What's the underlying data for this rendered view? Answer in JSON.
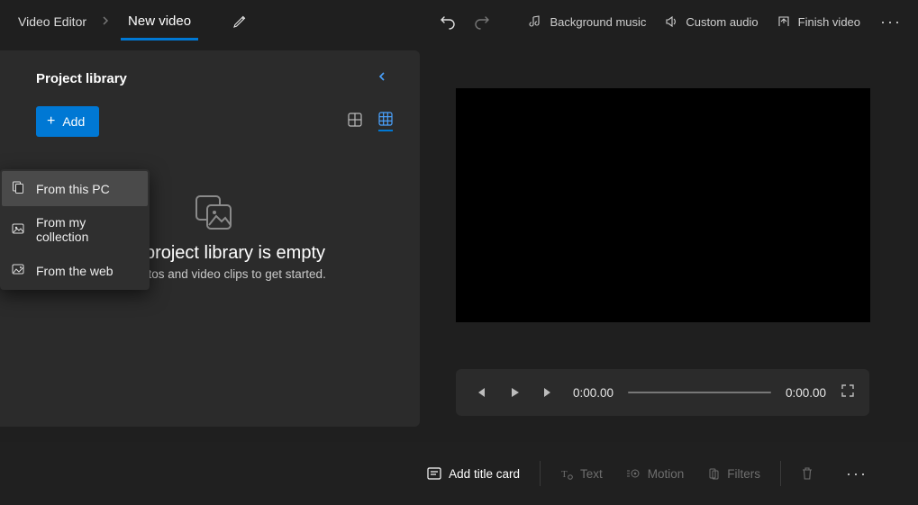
{
  "topbar": {
    "app_name": "Video Editor",
    "project_name": "New video",
    "actions": {
      "bg_music": "Background music",
      "custom_audio": "Custom audio",
      "finish": "Finish video"
    }
  },
  "library": {
    "title": "Project library",
    "add_label": "Add",
    "empty_title": "Your project library is empty",
    "empty_sub": "Add photos and video clips to get started."
  },
  "add_menu": {
    "from_pc": "From this PC",
    "from_collection": "From my collection",
    "from_web": "From the web"
  },
  "player": {
    "current_time": "0:00.00",
    "total_time": "0:00.00"
  },
  "storybar": {
    "add_title_card": "Add title card",
    "text": "Text",
    "motion": "Motion",
    "filters": "Filters"
  }
}
